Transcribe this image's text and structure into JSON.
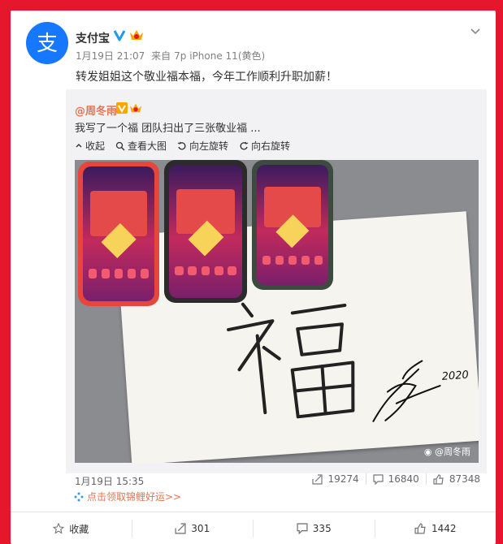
{
  "post": {
    "author": "支付宝",
    "verified": "V",
    "date": "1月19日 21:07",
    "via_prefix": "来自",
    "via_device": "7p iPhone 11(黄色)",
    "text": "转发姐姐这个敬业福本福，今年工作顺利升职加薪！"
  },
  "repost": {
    "author": "@周冬雨",
    "text": "我写了一个福  团队扫出了三张敬业福 ...",
    "tools": [
      {
        "label": "收起",
        "icon": "collapse-icon"
      },
      {
        "label": "查看大图",
        "icon": "zoom-icon"
      },
      {
        "label": "向左旋转",
        "icon": "rotate-left-icon"
      },
      {
        "label": "向右旋转",
        "icon": "rotate-right-icon"
      }
    ],
    "watermark": "@周冬雨",
    "date": "1月19日 15:35",
    "stats": {
      "reposts": "19274",
      "comments": "16840",
      "likes": "87348"
    }
  },
  "lucky_link": "点击领取锦鲤好运>>",
  "actions": {
    "favorite": "收藏",
    "repost": "301",
    "comment": "335",
    "like": "1442"
  },
  "colors": {
    "background": "#e6162d",
    "alipay_blue": "#1677ff",
    "link_orange": "#eb7350"
  }
}
